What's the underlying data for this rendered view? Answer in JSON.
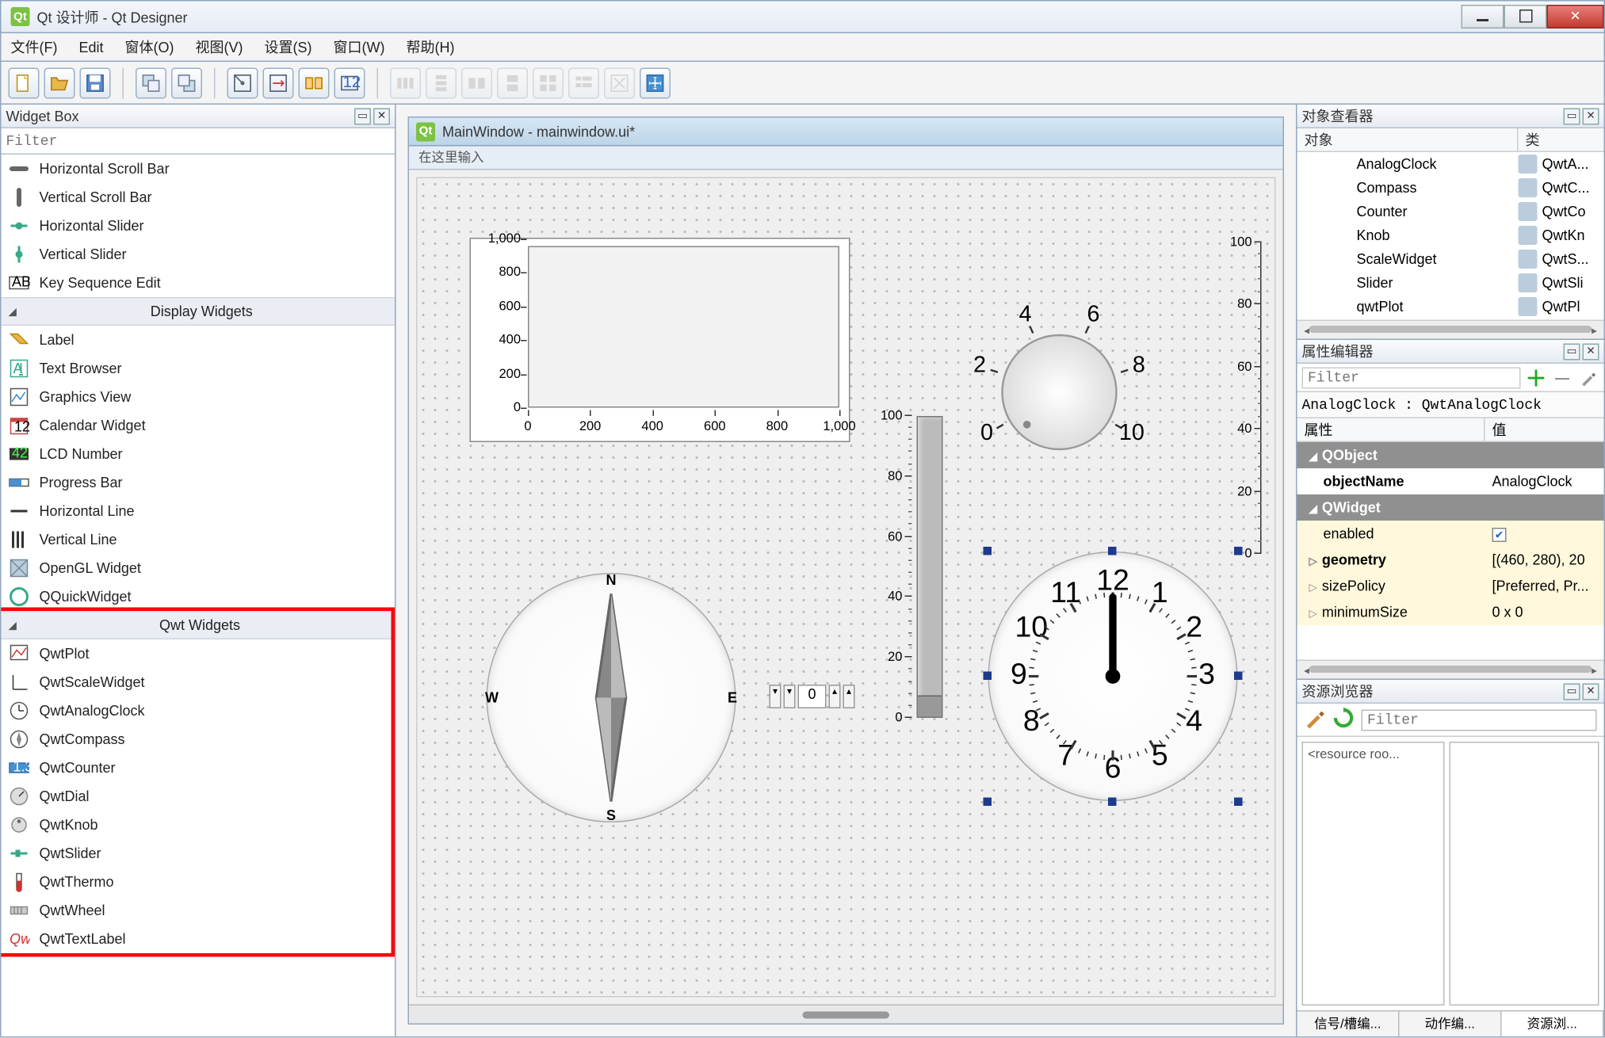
{
  "window": {
    "title": "Qt 设计师 - Qt Designer",
    "app_icon_text": "Qt"
  },
  "menu": {
    "file": "文件(F)",
    "edit": "Edit",
    "form": "窗体(O)",
    "view": "视图(V)",
    "settings": "设置(S)",
    "window": "窗口(W)",
    "help": "帮助(H)"
  },
  "widget_box": {
    "title": "Widget Box",
    "filter_placeholder": "Filter",
    "items_top": [
      "Horizontal Scroll Bar",
      "Vertical Scroll Bar",
      "Horizontal Slider",
      "Vertical Slider",
      "Key Sequence Edit"
    ],
    "display_group": "Display Widgets",
    "display_items": [
      "Label",
      "Text Browser",
      "Graphics View",
      "Calendar Widget",
      "LCD Number",
      "Progress Bar",
      "Horizontal Line",
      "Vertical Line",
      "OpenGL Widget",
      "QQuickWidget"
    ],
    "qwt_group": "Qwt Widgets",
    "qwt_items": [
      "QwtPlot",
      "QwtScaleWidget",
      "QwtAnalogClock",
      "QwtCompass",
      "QwtCounter",
      "QwtDial",
      "QwtKnob",
      "QwtSlider",
      "QwtThermo",
      "QwtWheel",
      "QwtTextLabel"
    ]
  },
  "design": {
    "sub_title": "MainWindow - mainwindow.ui*",
    "type_here": "在这里输入",
    "plot": {
      "y_ticks": [
        "1,000",
        "800",
        "600",
        "400",
        "200",
        "0"
      ],
      "x_ticks": [
        "0",
        "200",
        "400",
        "600",
        "800",
        "1,000"
      ]
    },
    "compass_labels": {
      "n": "N",
      "s": "S",
      "e": "E",
      "w": "W"
    },
    "knob_ticks": [
      "0",
      "2",
      "4",
      "6",
      "8",
      "10"
    ],
    "big_scale_ticks": [
      "0",
      "20",
      "40",
      "60",
      "80",
      "100"
    ],
    "thermo_ticks": [
      "0",
      "20",
      "40",
      "60",
      "80",
      "100"
    ],
    "counter_value": "0",
    "clock_numbers": [
      "12",
      "1",
      "2",
      "3",
      "4",
      "5",
      "6",
      "7",
      "8",
      "9",
      "10",
      "11"
    ]
  },
  "obj_inspector": {
    "title": "对象查看器",
    "col_name": "对象",
    "col_class": "类",
    "rows": [
      {
        "name": "AnalogClock",
        "cls": "QwtA..."
      },
      {
        "name": "Compass",
        "cls": "QwtC..."
      },
      {
        "name": "Counter",
        "cls": "QwtCo"
      },
      {
        "name": "Knob",
        "cls": "QwtKn"
      },
      {
        "name": "ScaleWidget",
        "cls": "QwtS..."
      },
      {
        "name": "Slider",
        "cls": "QwtSli"
      },
      {
        "name": "qwtPlot",
        "cls": "QwtPl"
      }
    ]
  },
  "prop_editor": {
    "title": "属性编辑器",
    "filter_placeholder": "Filter",
    "info": "AnalogClock : QwtAnalogClock",
    "col_prop": "属性",
    "col_val": "值",
    "groups": [
      {
        "type": "header",
        "name": "QObject"
      },
      {
        "type": "prop",
        "name": "objectName",
        "value": "AnalogClock",
        "bold": true,
        "bg": "plain"
      },
      {
        "type": "header",
        "name": "QWidget"
      },
      {
        "type": "prop",
        "name": "enabled",
        "value": "check",
        "bg": "yellow"
      },
      {
        "type": "prop",
        "name": "geometry",
        "value": "[(460, 280), 20",
        "bold": true,
        "bg": "yellow",
        "expand": true
      },
      {
        "type": "prop",
        "name": "sizePolicy",
        "value": "[Preferred, Pr...",
        "bg": "yellow",
        "expand": true
      },
      {
        "type": "prop",
        "name": "minimumSize",
        "value": "0 x 0",
        "bg": "yellow",
        "expand": true
      }
    ]
  },
  "res_browser": {
    "title": "资源浏览器",
    "filter_placeholder": "Filter",
    "root": "<resource roo...",
    "tabs": [
      "信号/槽编...",
      "动作编...",
      "资源浏..."
    ]
  }
}
